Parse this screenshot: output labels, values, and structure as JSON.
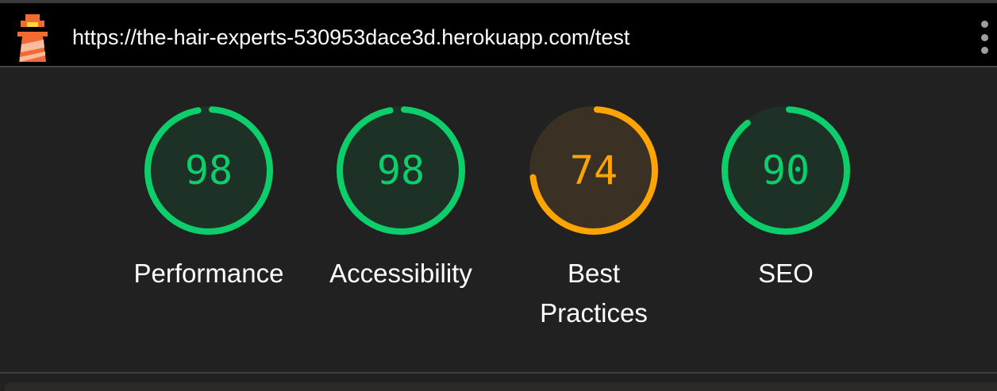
{
  "header": {
    "url": "https://the-hair-experts-530953dace3d.herokuapp.com/test",
    "logo_icon": "lighthouse-icon",
    "menu_icon": "kebab-menu-icon"
  },
  "gauges": [
    {
      "label": "Performance",
      "score": "98",
      "value": 98,
      "status": "pass",
      "color": "#0cce6b",
      "fill": "#1e3126"
    },
    {
      "label": "Accessibility",
      "score": "98",
      "value": 98,
      "status": "pass",
      "color": "#0cce6b",
      "fill": "#1e3126"
    },
    {
      "label": "Best Practices",
      "score": "74",
      "value": 74,
      "status": "average",
      "color": "#ffa400",
      "fill": "#3a3124"
    },
    {
      "label": "SEO",
      "score": "90",
      "value": 90,
      "status": "pass",
      "color": "#0cce6b",
      "fill": "#1e3126"
    }
  ],
  "colors": {
    "background": "#212121",
    "url_bar": "#000000",
    "label_text": "#ffffff"
  }
}
